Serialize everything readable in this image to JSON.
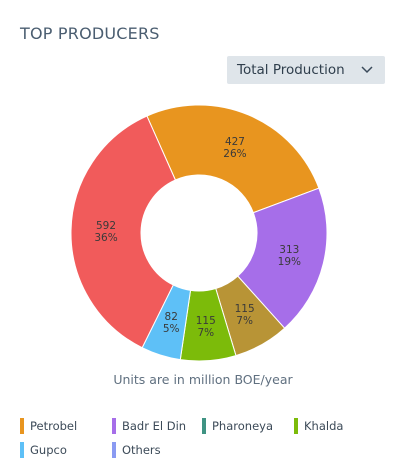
{
  "header": {
    "title": "TOP PRODUCERS"
  },
  "filter": {
    "selected": "Total Production",
    "chevron_icon": "chevron-down-icon"
  },
  "note": "Units are in million BOE/year",
  "chart_data": {
    "type": "pie",
    "donut": true,
    "categories": [
      "Petrobel",
      "Badr El Din",
      "Pharoneya",
      "Khalda",
      "Gupco",
      "Others"
    ],
    "slices": [
      {
        "name": "Petrobel",
        "value": 427,
        "percent": "26%",
        "color": "#e8951f"
      },
      {
        "name": "Badr El Din",
        "value": 313,
        "percent": "19%",
        "color": "#a66ee9"
      },
      {
        "name": "Pharoneya",
        "value": 115,
        "percent": "7%",
        "color": "#b89436"
      },
      {
        "name": "Khalda",
        "value": 115,
        "percent": "7%",
        "color": "#7cbb0a"
      },
      {
        "name": "Gupco",
        "value": 82,
        "percent": "5%",
        "color": "#5ec0f7"
      },
      {
        "name": "Others",
        "value": 592,
        "percent": "36%",
        "color": "#f15b5b"
      }
    ],
    "legend": [
      {
        "name": "Petrobel",
        "color": "#e8951f"
      },
      {
        "name": "Badr El Din",
        "color": "#a66ee9"
      },
      {
        "name": "Pharoneya",
        "color": "#3f9383"
      },
      {
        "name": "Khalda",
        "color": "#7cbb0a"
      },
      {
        "name": "Gupco",
        "color": "#5ec0f7"
      },
      {
        "name": "Others",
        "color": "#8a9af2"
      }
    ],
    "legend_position": "bottom"
  }
}
